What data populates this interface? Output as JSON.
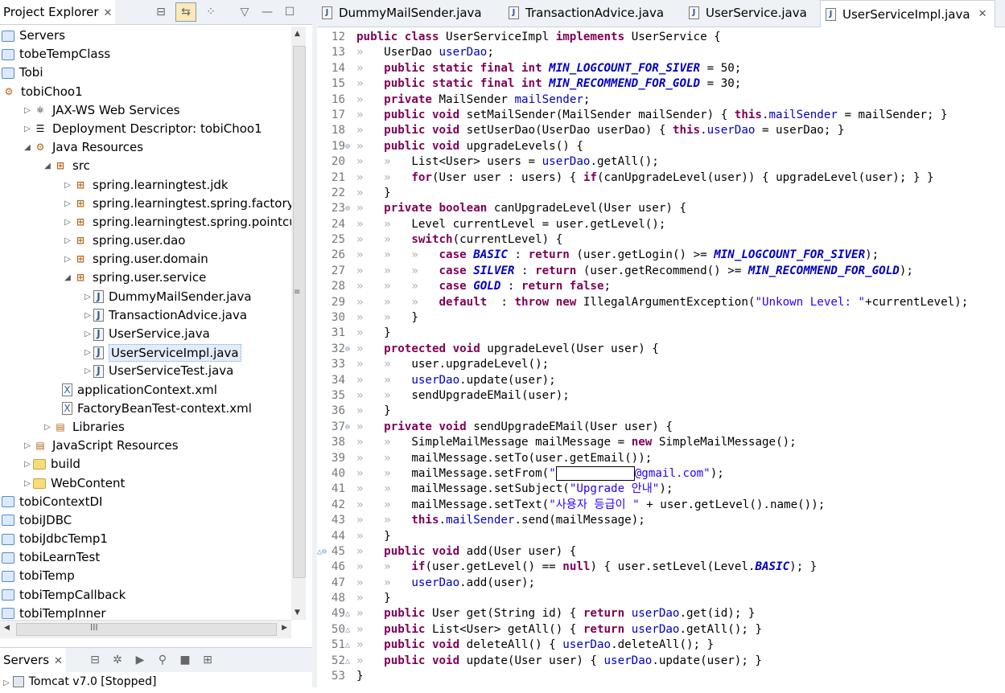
{
  "project_explorer": {
    "tab_label": "Project Explorer",
    "tree": [
      {
        "label": "Servers",
        "indent": 0,
        "twisty": "",
        "icon": "folder"
      },
      {
        "label": "tobeTempClass",
        "indent": 0,
        "twisty": "",
        "icon": "folder"
      },
      {
        "label": "Tobi",
        "indent": 0,
        "twisty": "",
        "icon": "folder"
      },
      {
        "label": "tobiChoo1",
        "indent": 0,
        "twisty": "",
        "icon": "project"
      },
      {
        "label": "JAX-WS Web Services",
        "indent": 1,
        "twisty": "▷",
        "icon": "ws"
      },
      {
        "label": "Deployment Descriptor: tobiChoo1",
        "indent": 1,
        "twisty": "▷",
        "icon": "dd"
      },
      {
        "label": "Java Resources",
        "indent": 1,
        "twisty": "◢",
        "icon": "jres"
      },
      {
        "label": "src",
        "indent": 2,
        "twisty": "◢",
        "icon": "src"
      },
      {
        "label": "spring.learningtest.jdk",
        "indent": 3,
        "twisty": "▷",
        "icon": "pkg"
      },
      {
        "label": "spring.learningtest.spring.factorybean",
        "indent": 3,
        "twisty": "▷",
        "icon": "pkg"
      },
      {
        "label": "spring.learningtest.spring.pointcut",
        "indent": 3,
        "twisty": "▷",
        "icon": "pkg"
      },
      {
        "label": "spring.user.dao",
        "indent": 3,
        "twisty": "▷",
        "icon": "pkg"
      },
      {
        "label": "spring.user.domain",
        "indent": 3,
        "twisty": "▷",
        "icon": "pkg"
      },
      {
        "label": "spring.user.service",
        "indent": 3,
        "twisty": "◢",
        "icon": "pkg"
      },
      {
        "label": "DummyMailSender.java",
        "indent": 4,
        "twisty": "▷",
        "icon": "java"
      },
      {
        "label": "TransactionAdvice.java",
        "indent": 4,
        "twisty": "▷",
        "icon": "java"
      },
      {
        "label": "UserService.java",
        "indent": 4,
        "twisty": "▷",
        "icon": "java"
      },
      {
        "label": "UserServiceImpl.java",
        "indent": 4,
        "twisty": "▷",
        "icon": "java",
        "selected": true
      },
      {
        "label": "UserServiceTest.java",
        "indent": 4,
        "twisty": "▷",
        "icon": "java"
      },
      {
        "label": "applicationContext.xml",
        "indent": 3,
        "twisty": "",
        "icon": "xml"
      },
      {
        "label": "FactoryBeanTest-context.xml",
        "indent": 3,
        "twisty": "",
        "icon": "xml"
      },
      {
        "label": "Libraries",
        "indent": 2,
        "twisty": "▷",
        "icon": "lib"
      },
      {
        "label": "JavaScript Resources",
        "indent": 1,
        "twisty": "▷",
        "icon": "lib"
      },
      {
        "label": "build",
        "indent": 1,
        "twisty": "▷",
        "icon": "ofolder"
      },
      {
        "label": "WebContent",
        "indent": 1,
        "twisty": "▷",
        "icon": "ofolder"
      },
      {
        "label": "tobiContextDI",
        "indent": 0,
        "twisty": "",
        "icon": "folder"
      },
      {
        "label": "tobiJDBC",
        "indent": 0,
        "twisty": "",
        "icon": "folder"
      },
      {
        "label": "tobiJdbcTemp1",
        "indent": 0,
        "twisty": "",
        "icon": "folder"
      },
      {
        "label": "tobiLearnTest",
        "indent": 0,
        "twisty": "",
        "icon": "folder"
      },
      {
        "label": "tobiTemp",
        "indent": 0,
        "twisty": "",
        "icon": "folder"
      },
      {
        "label": "tobiTempCallback",
        "indent": 0,
        "twisty": "",
        "icon": "folder"
      },
      {
        "label": "tobiTempInner",
        "indent": 0,
        "twisty": "",
        "icon": "folder"
      }
    ]
  },
  "servers_view": {
    "tab_label": "Servers",
    "row_label": "Tomcat v7.0 ",
    "row_status": "[Stopped]"
  },
  "editor": {
    "tabs": [
      {
        "label": "DummyMailSender.java"
      },
      {
        "label": "TransactionAdvice.java"
      },
      {
        "label": "UserService.java"
      },
      {
        "label": "UserServiceImpl.java",
        "active": true
      }
    ],
    "code": [
      {
        "n": "12",
        "fold": "",
        "t": [
          [
            "k",
            "public class "
          ],
          [
            "",
            "UserServiceImpl "
          ],
          [
            "k",
            "implements "
          ],
          [
            "",
            "UserService {"
          ]
        ]
      },
      {
        "n": "13",
        "fold": "",
        "t": [
          [
            "g",
            "»   "
          ],
          [
            "",
            "UserDao "
          ],
          [
            "f",
            "userDao"
          ],
          [
            "",
            ";"
          ]
        ]
      },
      {
        "n": "14",
        "fold": "",
        "t": [
          [
            "g",
            "»   "
          ],
          [
            "k",
            "public static final int "
          ],
          [
            "sf",
            "MIN_LOGCOUNT_FOR_SIVER"
          ],
          [
            "",
            " = 50;"
          ]
        ]
      },
      {
        "n": "15",
        "fold": "",
        "t": [
          [
            "g",
            "»   "
          ],
          [
            "k",
            "public static final int "
          ],
          [
            "sf",
            "MIN_RECOMMEND_FOR_GOLD"
          ],
          [
            "",
            " = 30;"
          ]
        ]
      },
      {
        "n": "16",
        "fold": "",
        "t": [
          [
            "g",
            "»   "
          ],
          [
            "k",
            "private "
          ],
          [
            "",
            "MailSender "
          ],
          [
            "f",
            "mailSender"
          ],
          [
            "",
            ";"
          ]
        ]
      },
      {
        "n": "17",
        "fold": "",
        "t": [
          [
            "g",
            "»   "
          ],
          [
            "k",
            "public void "
          ],
          [
            "",
            "setMailSender(MailSender mailSender) { "
          ],
          [
            "k",
            "this"
          ],
          [
            "",
            "."
          ],
          [
            "f",
            "mailSender"
          ],
          [
            "",
            " = mailSender; }"
          ]
        ]
      },
      {
        "n": "18",
        "fold": "",
        "t": [
          [
            "g",
            "»   "
          ],
          [
            "k",
            "public void "
          ],
          [
            "",
            "setUserDao(UserDao userDao) { "
          ],
          [
            "k",
            "this"
          ],
          [
            "",
            "."
          ],
          [
            "f",
            "userDao"
          ],
          [
            "",
            " = userDao; }"
          ]
        ]
      },
      {
        "n": "19",
        "fold": "⊖",
        "t": [
          [
            "g",
            "»   "
          ],
          [
            "k",
            "public void "
          ],
          [
            "",
            "upgradeLevels() {"
          ]
        ]
      },
      {
        "n": "20",
        "fold": "",
        "t": [
          [
            "g",
            "»   »   "
          ],
          [
            "",
            "List<User> users = "
          ],
          [
            "f",
            "userDao"
          ],
          [
            "",
            ".getAll();"
          ]
        ]
      },
      {
        "n": "21",
        "fold": "",
        "t": [
          [
            "g",
            "»   »   "
          ],
          [
            "k",
            "for"
          ],
          [
            "",
            "(User user : users) { "
          ],
          [
            "k",
            "if"
          ],
          [
            "",
            "(canUpgradeLevel(user)) { upgradeLevel(user); } }"
          ]
        ]
      },
      {
        "n": "22",
        "fold": "",
        "t": [
          [
            "g",
            "»   "
          ],
          [
            "",
            "}"
          ]
        ]
      },
      {
        "n": "23",
        "fold": "⊖",
        "t": [
          [
            "g",
            "»   "
          ],
          [
            "k",
            "private boolean "
          ],
          [
            "",
            "canUpgradeLevel(User user) {"
          ]
        ]
      },
      {
        "n": "24",
        "fold": "",
        "t": [
          [
            "g",
            "»   »   "
          ],
          [
            "",
            "Level currentLevel = user.getLevel();"
          ]
        ]
      },
      {
        "n": "25",
        "fold": "",
        "t": [
          [
            "g",
            "»   »   "
          ],
          [
            "k",
            "switch"
          ],
          [
            "",
            "(currentLevel) {"
          ]
        ]
      },
      {
        "n": "26",
        "fold": "",
        "t": [
          [
            "g",
            "»   »   »   "
          ],
          [
            "k",
            "case "
          ],
          [
            "sf",
            "BASIC"
          ],
          [
            "",
            " : "
          ],
          [
            "k",
            "return "
          ],
          [
            "",
            "(user.getLogin() >= "
          ],
          [
            "sf",
            "MIN_LOGCOUNT_FOR_SIVER"
          ],
          [
            "",
            ");"
          ]
        ]
      },
      {
        "n": "27",
        "fold": "",
        "t": [
          [
            "g",
            "»   »   »   "
          ],
          [
            "k",
            "case "
          ],
          [
            "sf",
            "SILVER"
          ],
          [
            "",
            " : "
          ],
          [
            "k",
            "return "
          ],
          [
            "",
            "(user.getRecommend() >= "
          ],
          [
            "sf",
            "MIN_RECOMMEND_FOR_GOLD"
          ],
          [
            "",
            ");"
          ]
        ]
      },
      {
        "n": "28",
        "fold": "",
        "t": [
          [
            "g",
            "»   »   »   "
          ],
          [
            "k",
            "case "
          ],
          [
            "sf",
            "GOLD"
          ],
          [
            "",
            " : "
          ],
          [
            "k",
            "return false"
          ],
          [
            "",
            ";"
          ]
        ]
      },
      {
        "n": "29",
        "fold": "",
        "t": [
          [
            "g",
            "»   »   »   "
          ],
          [
            "k",
            "default "
          ],
          [
            "",
            " : "
          ],
          [
            "k",
            "throw new "
          ],
          [
            "",
            "IllegalArgumentException("
          ],
          [
            "s",
            "\"Unkown Level: \""
          ],
          [
            "",
            "+currentLevel);"
          ]
        ]
      },
      {
        "n": "30",
        "fold": "",
        "t": [
          [
            "g",
            "»   »   "
          ],
          [
            "",
            "}"
          ]
        ]
      },
      {
        "n": "31",
        "fold": "",
        "t": [
          [
            "g",
            "»   "
          ],
          [
            "",
            "}"
          ]
        ]
      },
      {
        "n": "32",
        "fold": "⊖",
        "t": [
          [
            "g",
            "»   "
          ],
          [
            "k",
            "protected void "
          ],
          [
            "",
            "upgradeLevel(User user) {"
          ]
        ]
      },
      {
        "n": "33",
        "fold": "",
        "t": [
          [
            "g",
            "»   »   "
          ],
          [
            "",
            "user.upgradeLevel();"
          ]
        ]
      },
      {
        "n": "34",
        "fold": "",
        "t": [
          [
            "g",
            "»   »   "
          ],
          [
            "f",
            "userDao"
          ],
          [
            "",
            ".update(user);"
          ]
        ]
      },
      {
        "n": "35",
        "fold": "",
        "t": [
          [
            "g",
            "»   »   "
          ],
          [
            "",
            "sendUpgradeEMail(user);"
          ]
        ]
      },
      {
        "n": "36",
        "fold": "",
        "t": [
          [
            "g",
            "»   "
          ],
          [
            "",
            "}"
          ]
        ]
      },
      {
        "n": "37",
        "fold": "⊖",
        "t": [
          [
            "g",
            "»   "
          ],
          [
            "k",
            "private void "
          ],
          [
            "",
            "sendUpgradeEMail(User user) {"
          ]
        ]
      },
      {
        "n": "38",
        "fold": "",
        "t": [
          [
            "g",
            "»   »   "
          ],
          [
            "",
            "SimpleMailMessage mailMessage = "
          ],
          [
            "k",
            "new "
          ],
          [
            "",
            "SimpleMailMessage();"
          ]
        ]
      },
      {
        "n": "39",
        "fold": "",
        "t": [
          [
            "g",
            "»   »   "
          ],
          [
            "",
            "mailMessage.setTo(user.getEmail());"
          ]
        ]
      },
      {
        "n": "40",
        "fold": "",
        "t": [
          [
            "g",
            "»   »   "
          ],
          [
            "",
            "mailMessage.setFrom("
          ],
          [
            "s",
            "\""
          ],
          [
            "redact",
            ""
          ],
          [
            "s",
            "@gmail.com\""
          ],
          [
            "",
            ");"
          ]
        ]
      },
      {
        "n": "41",
        "fold": "",
        "t": [
          [
            "g",
            "»   »   "
          ],
          [
            "",
            "mailMessage.setSubject("
          ],
          [
            "s",
            "\"Upgrade 안내\""
          ],
          [
            "",
            ");"
          ]
        ]
      },
      {
        "n": "42",
        "fold": "",
        "t": [
          [
            "g",
            "»   »   "
          ],
          [
            "",
            "mailMessage.setText("
          ],
          [
            "s",
            "\"사용자 등급이 \""
          ],
          [
            "",
            " + user.getLevel().name());"
          ]
        ]
      },
      {
        "n": "43",
        "fold": "",
        "t": [
          [
            "g",
            "»   »   "
          ],
          [
            "k",
            "this"
          ],
          [
            "",
            "."
          ],
          [
            "f",
            "mailSender"
          ],
          [
            "",
            ".send(mailMessage);"
          ]
        ]
      },
      {
        "n": "44",
        "fold": "",
        "t": [
          [
            "g",
            "»   "
          ],
          [
            "",
            "}"
          ]
        ]
      },
      {
        "n": "45",
        "fold": "△⊖",
        "t": [
          [
            "g",
            "»   "
          ],
          [
            "k",
            "public void "
          ],
          [
            "",
            "add(User user) {"
          ]
        ]
      },
      {
        "n": "46",
        "fold": "",
        "t": [
          [
            "g",
            "»   »   "
          ],
          [
            "k",
            "if"
          ],
          [
            "",
            "(user.getLevel() == "
          ],
          [
            "k",
            "null"
          ],
          [
            "",
            ") { user.setLevel(Level."
          ],
          [
            "sf",
            "BASIC"
          ],
          [
            "",
            "); }"
          ]
        ]
      },
      {
        "n": "47",
        "fold": "",
        "t": [
          [
            "g",
            "»   »   "
          ],
          [
            "f",
            "userDao"
          ],
          [
            "",
            ".add(user);"
          ]
        ]
      },
      {
        "n": "48",
        "fold": "",
        "t": [
          [
            "g",
            "»   "
          ],
          [
            "",
            "}"
          ]
        ]
      },
      {
        "n": "49",
        "fold": "△",
        "t": [
          [
            "g",
            "»   "
          ],
          [
            "k",
            "public "
          ],
          [
            "",
            "User get(String id) { "
          ],
          [
            "k",
            "return "
          ],
          [
            "f",
            "userDao"
          ],
          [
            "",
            ".get(id); }"
          ]
        ]
      },
      {
        "n": "50",
        "fold": "△",
        "t": [
          [
            "g",
            "»   "
          ],
          [
            "k",
            "public "
          ],
          [
            "",
            "List<User> getAll() { "
          ],
          [
            "k",
            "return "
          ],
          [
            "f",
            "userDao"
          ],
          [
            "",
            ".getAll(); }"
          ]
        ]
      },
      {
        "n": "51",
        "fold": "△",
        "t": [
          [
            "g",
            "»   "
          ],
          [
            "k",
            "public void "
          ],
          [
            "",
            "deleteAll() { "
          ],
          [
            "f",
            "userDao"
          ],
          [
            "",
            ".deleteAll(); }"
          ]
        ]
      },
      {
        "n": "52",
        "fold": "△",
        "t": [
          [
            "g",
            "»   "
          ],
          [
            "k",
            "public void "
          ],
          [
            "",
            "update(User user) { "
          ],
          [
            "f",
            "userDao"
          ],
          [
            "",
            ".update(user); }"
          ]
        ]
      },
      {
        "n": "53",
        "fold": "",
        "t": [
          [
            "",
            "}"
          ]
        ]
      }
    ]
  }
}
